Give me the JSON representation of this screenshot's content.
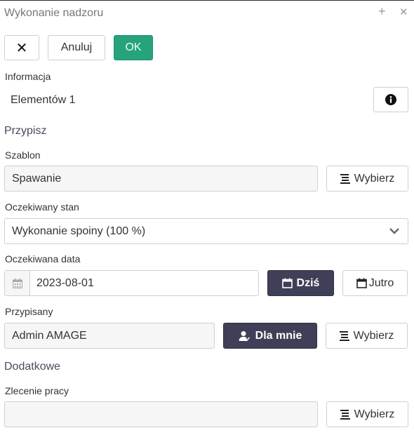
{
  "dialog": {
    "title": "Wykonanie nadzoru",
    "plus_glyph": "+",
    "close_glyph": "✕"
  },
  "toolbar": {
    "close_label": "✕",
    "cancel_label": "Anuluj",
    "ok_label": "OK"
  },
  "info": {
    "heading": "Informacja",
    "value": "Elementów 1",
    "button_glyph": "i"
  },
  "assign": {
    "heading": "Przypisz",
    "template": {
      "label": "Szablon",
      "value": "Spawanie",
      "choose_label": "Wybierz"
    },
    "expected_state": {
      "label": "Oczekiwany stan",
      "value": "Wykonanie spoiny (100 %)"
    },
    "expected_date": {
      "label": "Oczekiwana data",
      "value": "2023-08-01",
      "today_label": "Dziś",
      "tomorrow_label": "Jutro"
    },
    "assignee": {
      "label": "Przypisany",
      "value": "Admin AMAGE",
      "for_me_label": "Dla mnie",
      "choose_label": "Wybierz"
    }
  },
  "additional": {
    "heading": "Dodatkowe",
    "work_order": {
      "label": "Zlecenie pracy",
      "value": "",
      "choose_label": "Wybierz"
    }
  },
  "colors": {
    "ok_button": "#26a37c",
    "dark_button": "#3f3f58",
    "field_background": "#f6f6f6",
    "border": "#cfcfcf"
  },
  "icons": [
    "close-icon",
    "plus-icon",
    "info-icon",
    "list-icon",
    "calendar-icon",
    "user-check-icon",
    "chevron-down-icon"
  ]
}
